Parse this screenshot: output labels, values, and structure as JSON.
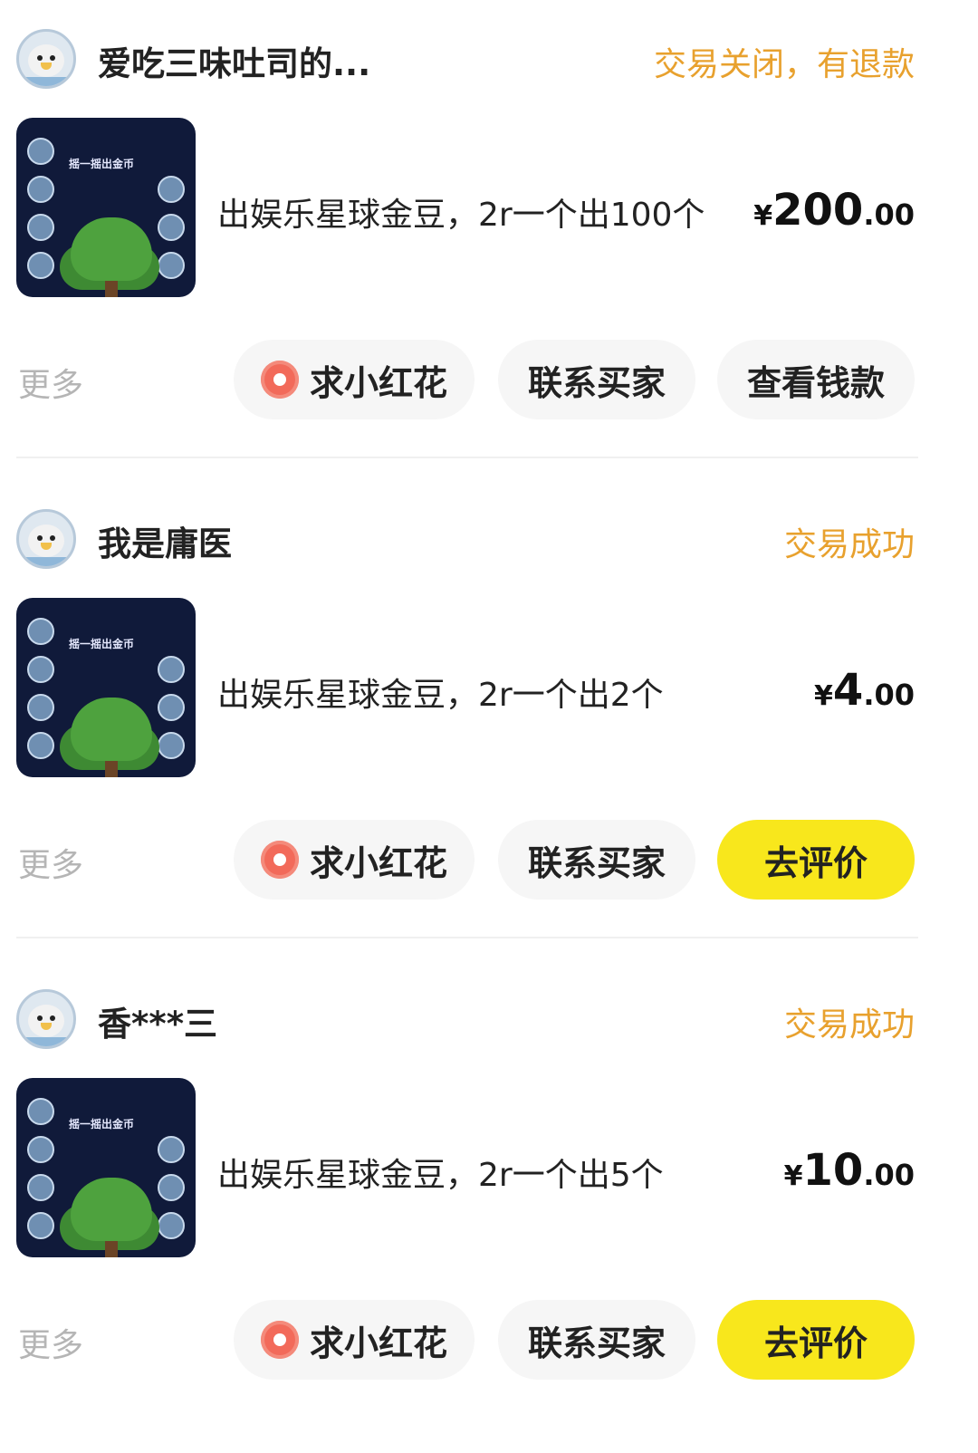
{
  "orders": [
    {
      "buyer": "爱吃三味吐司的...",
      "status": "交易关闭，有退款",
      "title": "出娱乐星球金豆，2r一个出100个",
      "price_symbol": "¥",
      "price_int": "200",
      "price_dec": ".00",
      "thumb_caption": "摇一摇出金币",
      "more": "更多",
      "btn_flower": "求小红花",
      "btn_contact": "联系买家",
      "btn_action": "查看钱款"
    },
    {
      "buyer": "我是庸医",
      "status": "交易成功",
      "title": "出娱乐星球金豆，2r一个出2个",
      "price_symbol": "¥",
      "price_int": "4",
      "price_dec": ".00",
      "thumb_caption": "摇一摇出金币",
      "more": "更多",
      "btn_flower": "求小红花",
      "btn_contact": "联系买家",
      "btn_action": "去评价"
    },
    {
      "buyer": "香***三",
      "status": "交易成功",
      "title": "出娱乐星球金豆，2r一个出5个",
      "price_symbol": "¥",
      "price_int": "10",
      "price_dec": ".00",
      "thumb_caption": "摇一摇出金币",
      "more": "更多",
      "btn_flower": "求小红花",
      "btn_contact": "联系买家",
      "btn_action": "去评价"
    }
  ],
  "colors": {
    "status": "#e8a12e",
    "action_yellow": "#f8e71c",
    "button_gray": "#f6f6f6"
  },
  "icons": [
    "avatar-seal-icon",
    "flower-icon"
  ]
}
